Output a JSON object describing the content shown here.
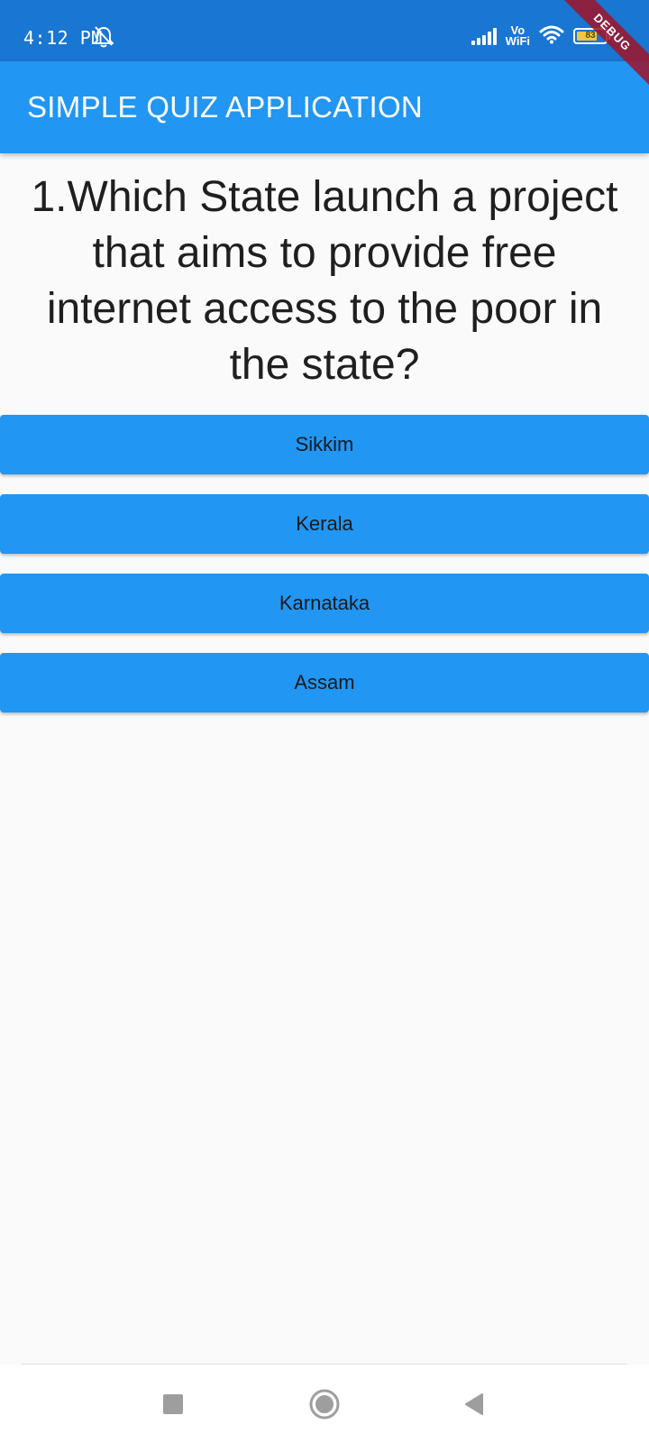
{
  "status_bar": {
    "time": "4:12 PM",
    "vowifi_top": "Vo",
    "vowifi_bottom": "WiFi",
    "battery_level": "83",
    "icons": [
      "bell-off-icon",
      "signal-icon",
      "wifi-icon",
      "battery-icon"
    ]
  },
  "debug_banner": "DEBUG",
  "app_bar": {
    "title": "SIMPLE QUIZ APPLICATION"
  },
  "quiz": {
    "question": "1.Which State launch a project that aims to provide free internet access to the poor in the state?",
    "answers": [
      {
        "label": "Sikkim"
      },
      {
        "label": "Kerala"
      },
      {
        "label": "Karnataka"
      },
      {
        "label": "Assam"
      }
    ]
  },
  "navigation": {
    "buttons": [
      "recents-icon",
      "home-icon",
      "back-icon"
    ]
  },
  "colors": {
    "status_bar": "#1976d2",
    "app_bar": "#2196f3",
    "button": "#2196f3",
    "background": "#fafafa",
    "debug_banner": "#a01428"
  }
}
